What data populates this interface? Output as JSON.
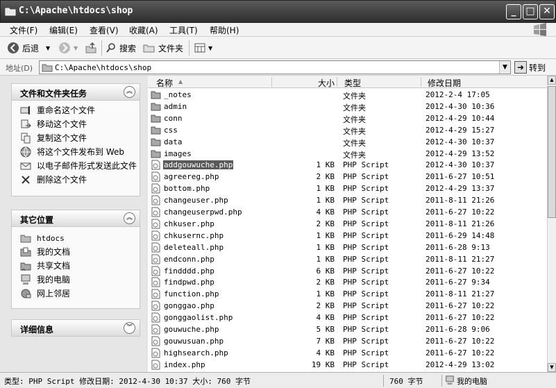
{
  "window": {
    "title": "C:\\Apache\\htdocs\\shop"
  },
  "menu": [
    "文件(F)",
    "编辑(E)",
    "查看(V)",
    "收藏(A)",
    "工具(T)",
    "帮助(H)"
  ],
  "toolbar": {
    "back": "后退",
    "search": "搜索",
    "folders": "文件夹"
  },
  "address": {
    "label": "地址(D)",
    "value": "C:\\Apache\\htdocs\\shop",
    "go": "转到"
  },
  "tasks": {
    "title": "文件和文件夹任务",
    "items": [
      "重命名这个文件",
      "移动这个文件",
      "复制这个文件",
      "将这个文件发布到 Web",
      "以电子邮件形式发送此文件",
      "删除这个文件"
    ]
  },
  "places": {
    "title": "其它位置",
    "items": [
      "htdocs",
      "我的文档",
      "共享文档",
      "我的电脑",
      "网上邻居"
    ]
  },
  "details": {
    "title": "详细信息"
  },
  "columns": {
    "name": "名称",
    "size": "大小",
    "type": "类型",
    "modified": "修改日期"
  },
  "files": [
    {
      "name": "_notes",
      "size": "",
      "type": "文件夹",
      "date": "2012-2-4 17:05",
      "folder": true
    },
    {
      "name": "admin",
      "size": "",
      "type": "文件夹",
      "date": "2012-4-30 10:36",
      "folder": true
    },
    {
      "name": "conn",
      "size": "",
      "type": "文件夹",
      "date": "2012-4-29 10:44",
      "folder": true
    },
    {
      "name": "css",
      "size": "",
      "type": "文件夹",
      "date": "2012-4-29 15:27",
      "folder": true
    },
    {
      "name": "data",
      "size": "",
      "type": "文件夹",
      "date": "2012-4-30 10:37",
      "folder": true
    },
    {
      "name": "images",
      "size": "",
      "type": "文件夹",
      "date": "2012-4-29 13:52",
      "folder": true
    },
    {
      "name": "addgouwuche.php",
      "size": "1 KB",
      "type": "PHP Script",
      "date": "2012-4-30 10:37",
      "selected": true
    },
    {
      "name": "agreereg.php",
      "size": "2 KB",
      "type": "PHP Script",
      "date": "2011-6-27 10:51"
    },
    {
      "name": "bottom.php",
      "size": "1 KB",
      "type": "PHP Script",
      "date": "2012-4-29 13:37"
    },
    {
      "name": "changeuser.php",
      "size": "1 KB",
      "type": "PHP Script",
      "date": "2011-8-11 21:26"
    },
    {
      "name": "changeuserpwd.php",
      "size": "4 KB",
      "type": "PHP Script",
      "date": "2011-6-27 10:22"
    },
    {
      "name": "chkuser.php",
      "size": "2 KB",
      "type": "PHP Script",
      "date": "2011-8-11 21:26"
    },
    {
      "name": "chkusernc.php",
      "size": "1 KB",
      "type": "PHP Script",
      "date": "2011-6-29 14:48"
    },
    {
      "name": "deleteall.php",
      "size": "1 KB",
      "type": "PHP Script",
      "date": "2011-6-28 9:13"
    },
    {
      "name": "endconn.php",
      "size": "1 KB",
      "type": "PHP Script",
      "date": "2011-8-11 21:27"
    },
    {
      "name": "findddd.php",
      "size": "6 KB",
      "type": "PHP Script",
      "date": "2011-6-27 10:22"
    },
    {
      "name": "findpwd.php",
      "size": "2 KB",
      "type": "PHP Script",
      "date": "2011-6-27 9:34"
    },
    {
      "name": "function.php",
      "size": "1 KB",
      "type": "PHP Script",
      "date": "2011-8-11 21:27"
    },
    {
      "name": "gonggao.php",
      "size": "2 KB",
      "type": "PHP Script",
      "date": "2011-6-27 10:22"
    },
    {
      "name": "gonggaolist.php",
      "size": "4 KB",
      "type": "PHP Script",
      "date": "2011-6-27 10:22"
    },
    {
      "name": "gouwuche.php",
      "size": "5 KB",
      "type": "PHP Script",
      "date": "2011-6-28 9:06"
    },
    {
      "name": "gouwusuan.php",
      "size": "7 KB",
      "type": "PHP Script",
      "date": "2011-6-27 10:22"
    },
    {
      "name": "highsearch.php",
      "size": "4 KB",
      "type": "PHP Script",
      "date": "2011-6-27 10:22"
    },
    {
      "name": "index.php",
      "size": "19 KB",
      "type": "PHP Script",
      "date": "2012-4-29 13:02"
    }
  ],
  "status": {
    "info": "类型: PHP Script 修改日期: 2012-4-30 10:37 大小: 760 字节",
    "size": "760 字节",
    "zone": "我的电脑"
  }
}
